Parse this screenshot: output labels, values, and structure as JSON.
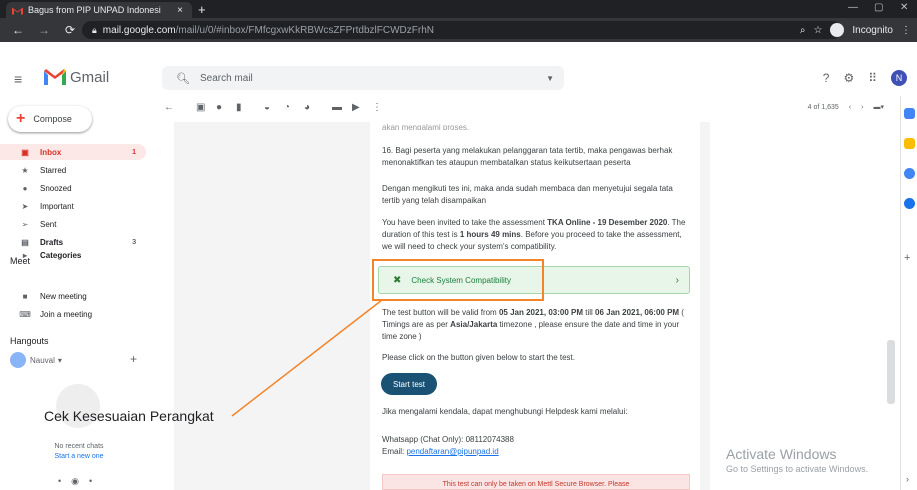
{
  "browser": {
    "tab_title": "Bagus from PIP UNPAD Indonesi",
    "tab_close": "×",
    "new_tab": "+",
    "win_min": "—",
    "win_max": "▢",
    "win_close": "✕",
    "url_host": "mail.google.com",
    "url_path": "/mail/u/0/#inbox/FMfcgxwKkRBWcsZFPrtdbzlFCWDzFrhN",
    "incognito_label": "Incognito"
  },
  "gmail": {
    "brand": "Gmail",
    "search_placeholder": "Search mail",
    "avatar_letter": "N"
  },
  "sidebar": {
    "compose": "Compose",
    "items": [
      {
        "label": "Inbox",
        "count": "1"
      },
      {
        "label": "Starred",
        "count": ""
      },
      {
        "label": "Snoozed",
        "count": ""
      },
      {
        "label": "Important",
        "count": ""
      },
      {
        "label": "Sent",
        "count": ""
      },
      {
        "label": "Drafts",
        "count": "3"
      },
      {
        "label": "Categories",
        "count": ""
      }
    ],
    "meet_title": "Meet",
    "meet_items": [
      "New meeting",
      "Join a meeting"
    ],
    "hangouts_title": "Hangouts",
    "hangout_user": "Nauval",
    "no_chats": "No recent chats",
    "start_new": "Start a new one"
  },
  "toolbar": {
    "pager": "4 of 1,635"
  },
  "message": {
    "top_cut": "akan mengalami proses.",
    "p16": "16.   Bagi peserta yang melakukan pelanggaran tata tertib, maka pengawas berhak menonaktifkan tes ataupun membatalkan status keikutsertaan peserta",
    "agree": "Dengan mengikuti tes ini, maka anda sudah membaca dan menyetujui segala tata tertib yang telah disampaikan",
    "invite_pre": "You have been invited to take the assessment ",
    "invite_bold": "TKA Online - 19 Desember 2020",
    "invite_mid": ". The duration of this test is ",
    "invite_dur": "1 hours 49 mins",
    "invite_post": ". Before you proceed to take the assessment, we will need to check your system's compatibility.",
    "check_btn": "Check System Compatibility",
    "valid_pre": "The test button will be valid from ",
    "valid_from": "05 Jan 2021, 03:00 PM",
    "valid_mid": " till ",
    "valid_to": "06 Jan 2021, 06:00 PM",
    "valid_post1": " ( Timings are as per ",
    "valid_tz": "Asia/Jakarta",
    "valid_post2": " timezone , please ensure the date and time in your time zone )",
    "click_below": "Please click on the button given below to start the test.",
    "start_btn": "Start test",
    "helpdesk": "Jika mengalami kendala, dapat menghubungi Helpdesk kami melalui:",
    "whatsapp": "Whatsapp (Chat Only): 08112074388",
    "email_label": "Email: ",
    "email": "pendaftaran@pipunpad.id",
    "pink_notice": "This test can only be taken on Mettl Secure Browser. Please"
  },
  "annotation": {
    "label": "Cek Kesesuaian Perangkat",
    "color": "#f4842a"
  },
  "watermark": {
    "line1": "Activate Windows",
    "line2": "Go to Settings to activate Windows."
  }
}
